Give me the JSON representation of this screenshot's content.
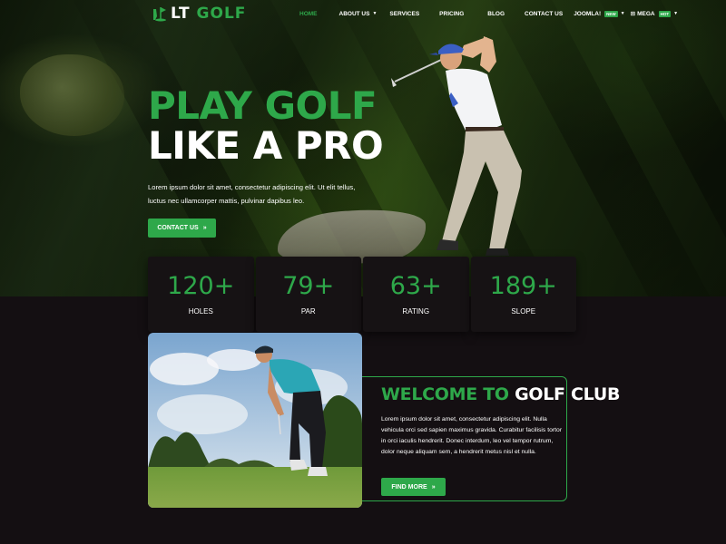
{
  "header": {
    "logo": {
      "prefix": "LT",
      "highlight": "GOLF"
    },
    "nav": [
      {
        "label": "HOME",
        "active": true,
        "dropdown": false
      },
      {
        "label": "ABOUT US",
        "active": false,
        "dropdown": true
      },
      {
        "label": "SERVICES",
        "active": false,
        "dropdown": false
      },
      {
        "label": "PRICING",
        "active": false,
        "dropdown": false
      },
      {
        "label": "BLOG",
        "active": false,
        "dropdown": false
      },
      {
        "label": "CONTACT US",
        "active": false,
        "dropdown": false
      }
    ],
    "joomla": {
      "label": "JOOMLA!",
      "badge": "NEW"
    },
    "mega": {
      "label": "MEGA",
      "badge": "HOT"
    }
  },
  "hero": {
    "title_line1": "PLAY GOLF",
    "title_line2": "LIKE A PRO",
    "description": "Lorem ipsum dolor sit amet, consectetur adipiscing elit. Ut elit tellus, luctus nec ullamcorper mattis, pulvinar dapibus leo.",
    "cta_label": "CONTACT US"
  },
  "stats": [
    {
      "value": "120+",
      "label": "HOLES"
    },
    {
      "value": "79+",
      "label": "PAR"
    },
    {
      "value": "63+",
      "label": "RATING"
    },
    {
      "value": "189+",
      "label": "SLOPE"
    }
  ],
  "welcome": {
    "title_highlight": "WELCOME TO",
    "title_rest": "GOLF CLUB",
    "text": "Lorem ipsum dolor sit amet, consectetur adipiscing elit. Nulla vehicula orci sed sapien maximus gravida. Curabitur facilisis tortor in orci iaculis hendrerit. Donec interdum, leo vel tempor rutrum, dolor neque aliquam sem, a hendrerit metus nisl et nulla.",
    "button_label": "FIND MORE"
  },
  "colors": {
    "accent": "#2ea84a",
    "background": "#140f12",
    "card": "#161214"
  }
}
